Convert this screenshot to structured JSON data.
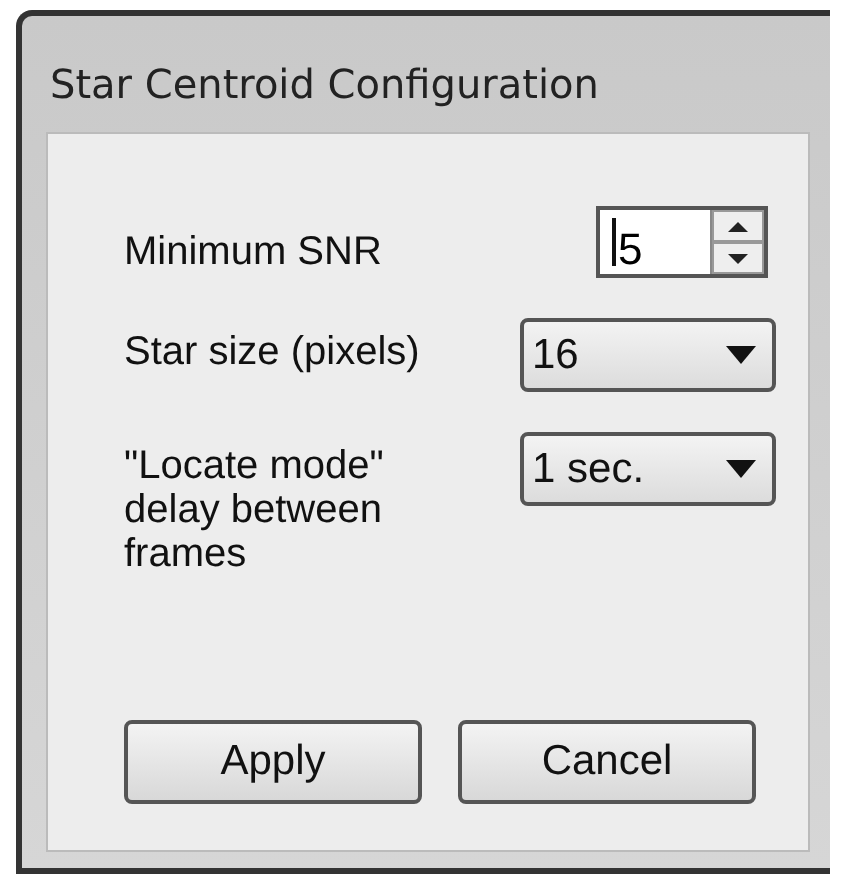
{
  "window": {
    "title": "Star Centroid Configuration"
  },
  "fields": [
    {
      "kind": "spin",
      "label": "Minimum SNR",
      "value": "5"
    },
    {
      "kind": "dropdown",
      "label": "Star size (pixels)",
      "value": "16"
    },
    {
      "kind": "dropdown",
      "label": "\"Locate mode\" delay between frames",
      "value": "1 sec."
    }
  ],
  "buttons": [
    "Apply",
    "Cancel"
  ]
}
